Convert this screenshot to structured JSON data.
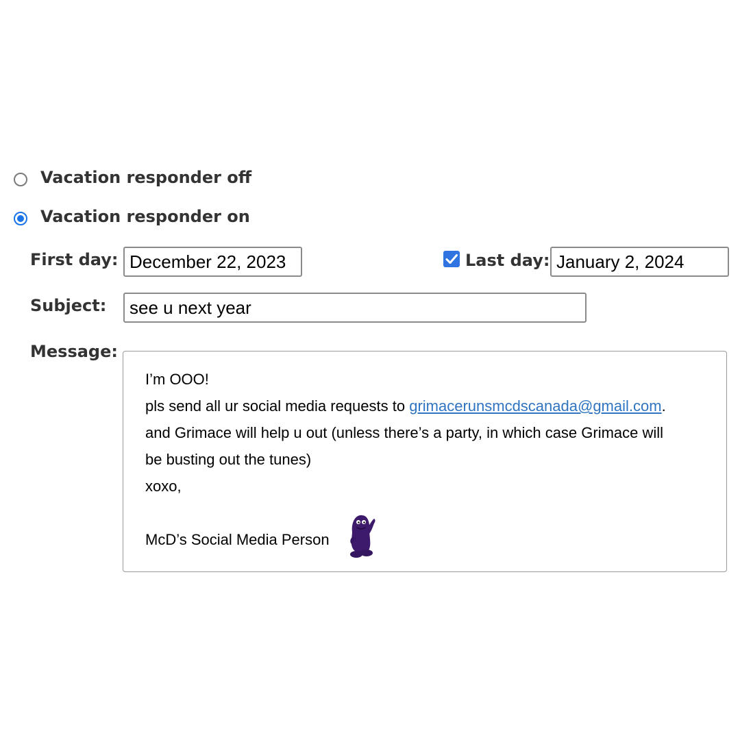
{
  "responder": {
    "off_label": "Vacation responder off",
    "on_label": "Vacation responder on",
    "selected": "on"
  },
  "first_day": {
    "label": "First day:",
    "value": "December 22, 2023"
  },
  "last_day": {
    "label": "Last day:",
    "value": "January 2, 2024",
    "checked": true
  },
  "subject": {
    "label": "Subject:",
    "value": "see u next year"
  },
  "message": {
    "label": "Message:",
    "line1": "I’m OOO!",
    "line2_prefix": "pls send all ur social media requests to ",
    "line2_email": "grimacerunsmcdscanada@gmail.com",
    "line2_suffix": ".",
    "line3": "and Grimace will help u out (unless there’s a party, in which case Grimace will",
    "line4": "be busting out the tunes)",
    "line5": "xoxo,",
    "line6": "McD’s Social Media Person",
    "sticker": "grimace-icon"
  },
  "colors": {
    "accent_blue": "#1a73e8",
    "checkbox_blue": "#2f74e0",
    "link_blue": "#2f74c0",
    "grimace_purple": "#3d1a6b"
  }
}
